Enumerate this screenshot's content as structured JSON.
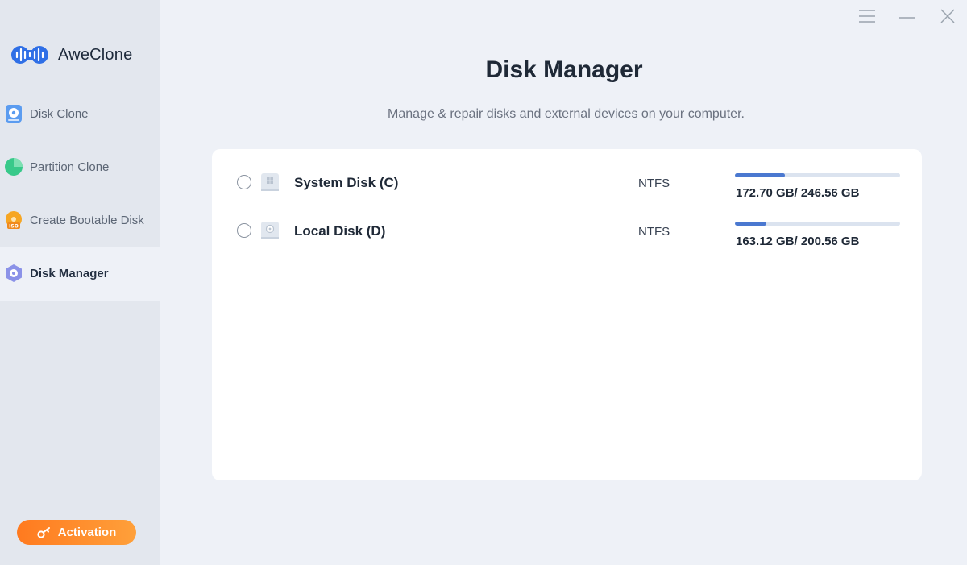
{
  "app": {
    "name": "AweClone"
  },
  "sidebar": {
    "items": [
      {
        "label": "Disk Clone",
        "icon": "disk-clone-icon",
        "active": false
      },
      {
        "label": "Partition Clone",
        "icon": "partition-clone-icon",
        "active": false
      },
      {
        "label": "Create Bootable Disk",
        "icon": "bootable-disk-icon",
        "active": false
      },
      {
        "label": "Disk Manager",
        "icon": "disk-manager-icon",
        "active": true
      }
    ],
    "activation_label": "Activation"
  },
  "window_controls": [
    "menu-icon",
    "minimize-icon",
    "close-icon"
  ],
  "main": {
    "title": "Disk Manager",
    "subtitle": "Manage & repair disks and external devices on your computer."
  },
  "disks": [
    {
      "name": "System Disk (C)",
      "filesystem": "NTFS",
      "usage": "172.70 GB/ 246.56 GB",
      "usage_fraction": 0.3,
      "icon": "windows-disk-icon",
      "selected": false
    },
    {
      "name": "Local Disk (D)",
      "filesystem": "NTFS",
      "usage": "163.12 GB/ 200.56 GB",
      "usage_fraction": 0.19,
      "icon": "local-disk-icon",
      "selected": false
    }
  ],
  "colors": {
    "accent": "#4a78d0",
    "activation": "#ff8a2a",
    "sidebar_bg": "#e3e7ee",
    "main_bg": "#eef1f7"
  }
}
